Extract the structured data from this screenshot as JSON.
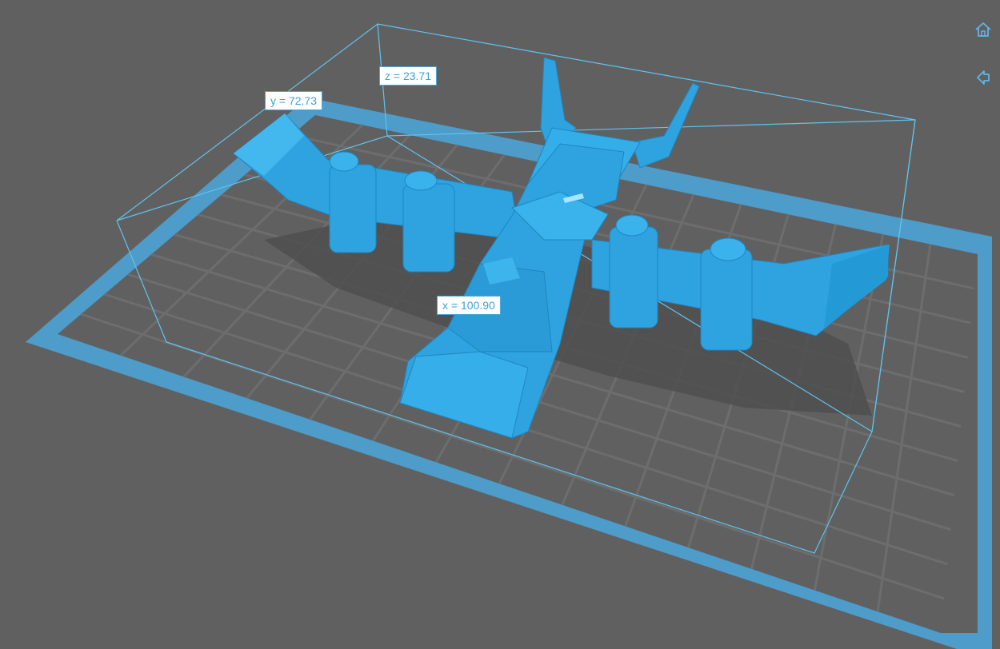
{
  "viewport": {
    "background_color": "#606060",
    "plate_color": "#4d9cc9",
    "grid_color": "#6d6d6d",
    "bbox_color": "#5fc3ee",
    "model_color": "#2ea3e0"
  },
  "dimensions": {
    "x_label": "x = 100.90",
    "y_label": "y = 72.73",
    "z_label": "z = 23.71"
  },
  "toolbar": {
    "home_icon": "home-icon",
    "back_icon": "arrow-left-icon"
  }
}
